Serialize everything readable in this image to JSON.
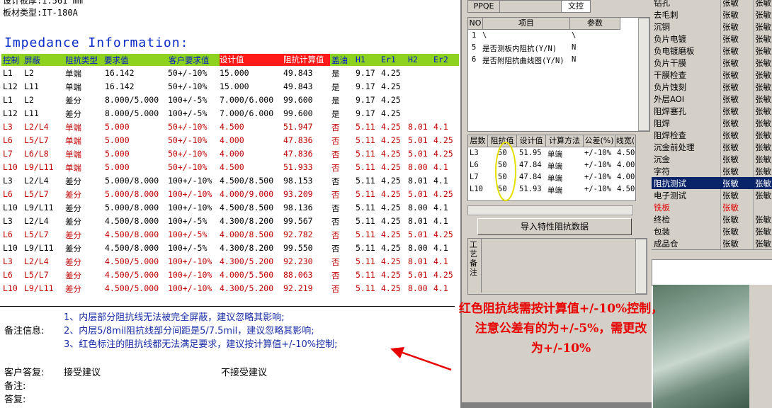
{
  "doc": {
    "header_line1": "设计板厚:1.561 mm",
    "header_line2": "板材类型:IT-180A",
    "impedance_title": "Impedance Information:",
    "columns": [
      "控制",
      "屏蔽",
      "阻抗类型",
      "要求值",
      "客户要求值",
      "设计值",
      "阻抗计算值",
      "盖油",
      "H1",
      "Er1",
      "H2",
      "Er2"
    ],
    "rows": [
      {
        "red": false,
        "c": [
          "L1",
          "L2",
          "单端",
          "16.142",
          "50+/-10%",
          "15.000",
          "49.843",
          "是",
          "9.17",
          "4.25",
          "",
          ""
        ]
      },
      {
        "red": false,
        "c": [
          "L12",
          "L11",
          "单端",
          "16.142",
          "50+/-10%",
          "15.000",
          "49.843",
          "是",
          "9.17",
          "4.25",
          "",
          ""
        ]
      },
      {
        "red": false,
        "c": [
          "L1",
          "L2",
          "差分",
          "8.000/5.000",
          "100+/-5%",
          "7.000/6.000",
          "99.600",
          "是",
          "9.17",
          "4.25",
          "",
          ""
        ]
      },
      {
        "red": false,
        "c": [
          "L12",
          "L11",
          "差分",
          "8.000/5.000",
          "100+/-5%",
          "7.000/6.000",
          "99.600",
          "是",
          "9.17",
          "4.25",
          "",
          ""
        ]
      },
      {
        "red": true,
        "c": [
          "L3",
          "L2/L4",
          "单端",
          "5.000",
          "50+/-10%",
          "4.500",
          "51.947",
          "否",
          "5.11",
          "4.25",
          "8.01",
          "4.1"
        ]
      },
      {
        "red": true,
        "c": [
          "L6",
          "L5/L7",
          "单端",
          "5.000",
          "50+/-10%",
          "4.000",
          "47.836",
          "否",
          "5.11",
          "4.25",
          "5.01",
          "4.25"
        ]
      },
      {
        "red": true,
        "c": [
          "L7",
          "L6/L8",
          "单端",
          "5.000",
          "50+/-10%",
          "4.000",
          "47.836",
          "否",
          "5.11",
          "4.25",
          "5.01",
          "4.25"
        ]
      },
      {
        "red": true,
        "c": [
          "L10",
          "L9/L11",
          "单端",
          "5.000",
          "50+/-10%",
          "4.500",
          "51.933",
          "否",
          "5.11",
          "4.25",
          "8.00",
          "4.1"
        ]
      },
      {
        "red": false,
        "c": [
          "L3",
          "L2/L4",
          "差分",
          "5.000/8.000",
          "100+/-10%",
          "4.500/8.500",
          "98.153",
          "否",
          "5.11",
          "4.25",
          "8.01",
          "4.1"
        ]
      },
      {
        "red": true,
        "c": [
          "L6",
          "L5/L7",
          "差分",
          "5.000/8.000",
          "100+/-10%",
          "4.000/9.000",
          "93.209",
          "否",
          "5.11",
          "4.25",
          "5.01",
          "4.25"
        ]
      },
      {
        "red": false,
        "c": [
          "L10",
          "L9/L11",
          "差分",
          "5.000/8.000",
          "100+/-10%",
          "4.500/8.500",
          "98.136",
          "否",
          "5.11",
          "4.25",
          "8.00",
          "4.1"
        ]
      },
      {
        "red": false,
        "c": [
          "L3",
          "L2/L4",
          "差分",
          "4.500/8.000",
          "100+/-5%",
          "4.300/8.200",
          "99.567",
          "否",
          "5.11",
          "4.25",
          "8.01",
          "4.1"
        ]
      },
      {
        "red": true,
        "c": [
          "L6",
          "L5/L7",
          "差分",
          "4.500/8.000",
          "100+/-5%",
          "4.000/8.500",
          "92.782",
          "否",
          "5.11",
          "4.25",
          "5.01",
          "4.25"
        ]
      },
      {
        "red": false,
        "c": [
          "L10",
          "L9/L11",
          "差分",
          "4.500/8.000",
          "100+/-5%",
          "4.300/8.200",
          "99.550",
          "否",
          "5.11",
          "4.25",
          "8.00",
          "4.1"
        ]
      },
      {
        "red": true,
        "c": [
          "L3",
          "L2/L4",
          "差分",
          "4.500/5.000",
          "100+/-10%",
          "4.300/5.200",
          "92.230",
          "否",
          "5.11",
          "4.25",
          "8.01",
          "4.1"
        ]
      },
      {
        "red": true,
        "c": [
          "L6",
          "L5/L7",
          "差分",
          "4.500/5.000",
          "100+/-10%",
          "4.000/5.500",
          "88.063",
          "否",
          "5.11",
          "4.25",
          "5.01",
          "4.25"
        ]
      },
      {
        "red": true,
        "c": [
          "L10",
          "L9/L11",
          "差分",
          "4.500/5.000",
          "100+/-10%",
          "4.300/5.200",
          "92.219",
          "否",
          "5.11",
          "4.25",
          "8.00",
          "4.1"
        ]
      }
    ],
    "notes_label": "备注信息:",
    "notes": [
      "1、内层部分阻抗线无法被完全屏蔽，建议忽略其影响;",
      "2、内层5/8mil阻抗线部分间距是5/7.5mil，建议忽略其影响;",
      "3、红色标注的阻抗线都无法满足要求，建议按计算值+/-10%控制;"
    ],
    "customer_reply_label": "客户答复:",
    "accept": "接受建议",
    "reject": "不接受建议",
    "remark_label": "备注:",
    "reply_label": "答复:"
  },
  "mid": {
    "tabs": [
      "PPQE",
      "",
      "文控"
    ],
    "param_headers": [
      "NO",
      "项目",
      "参数"
    ],
    "params": [
      {
        "no": "1",
        "item": "\\",
        "val": "\\"
      },
      {
        "no": "5",
        "item": "是否测板内阻抗(Y/N)",
        "val": "N"
      },
      {
        "no": "6",
        "item": "是否附阻抗曲线图(Y/N)",
        "val": "N"
      }
    ],
    "imp_headers": [
      "层数",
      "阻抗值",
      "设计值",
      "计算方法",
      "公差(%)",
      "线宽("
    ],
    "imp_rows": [
      [
        "L3",
        "50",
        "51.95",
        "单端",
        "+/-10%",
        "4.50"
      ],
      [
        "L6",
        "50",
        "47.84",
        "单端",
        "+/-10%",
        "4.00"
      ],
      [
        "L7",
        "50",
        "47.84",
        "单端",
        "+/-10%",
        "4.00"
      ],
      [
        "L10",
        "50",
        "51.93",
        "单端",
        "+/-10%",
        "4.50"
      ]
    ],
    "import_button": "导入特性阻抗数据",
    "craft_note_label": "工艺备注"
  },
  "right_list": [
    {
      "step": "钻孔",
      "p1": "张敏",
      "p2": "张敏",
      "sel": false,
      "red": false
    },
    {
      "step": "去毛刺",
      "p1": "张敏",
      "p2": "张敏",
      "sel": false,
      "red": false
    },
    {
      "step": "沉铜",
      "p1": "张敏",
      "p2": "张敏",
      "sel": false,
      "red": false
    },
    {
      "step": "负片电镀",
      "p1": "张敏",
      "p2": "张敏",
      "sel": false,
      "red": false
    },
    {
      "step": "负电镀磨板",
      "p1": "张敏",
      "p2": "张敏",
      "sel": false,
      "red": false
    },
    {
      "step": "负片干膜",
      "p1": "张敏",
      "p2": "张敏",
      "sel": false,
      "red": false
    },
    {
      "step": "干膜检查",
      "p1": "张敏",
      "p2": "张敏",
      "sel": false,
      "red": false
    },
    {
      "step": "负片蚀刻",
      "p1": "张敏",
      "p2": "张敏",
      "sel": false,
      "red": false
    },
    {
      "step": "外层AOI",
      "p1": "张敏",
      "p2": "张敏",
      "sel": false,
      "red": false
    },
    {
      "step": "阻焊塞孔",
      "p1": "张敏",
      "p2": "张敏",
      "sel": false,
      "red": false
    },
    {
      "step": "阻焊",
      "p1": "张敏",
      "p2": "张敏",
      "sel": false,
      "red": false
    },
    {
      "step": "阻焊检查",
      "p1": "张敏",
      "p2": "张敏",
      "sel": false,
      "red": false
    },
    {
      "step": "沉金前处理",
      "p1": "张敏",
      "p2": "张敏",
      "sel": false,
      "red": false
    },
    {
      "step": "沉金",
      "p1": "张敏",
      "p2": "张敏",
      "sel": false,
      "red": false
    },
    {
      "step": "字符",
      "p1": "张敏",
      "p2": "张敏",
      "sel": false,
      "red": false
    },
    {
      "step": "阻抗测试",
      "p1": "张敏",
      "p2": "张敏",
      "sel": true,
      "red": false
    },
    {
      "step": "电子测试",
      "p1": "张敏",
      "p2": "张敏",
      "sel": false,
      "red": false
    },
    {
      "step": "铣板",
      "p1": "张敏",
      "p2": "",
      "sel": false,
      "red": true
    },
    {
      "step": "终检",
      "p1": "张敏",
      "p2": "张敏",
      "sel": false,
      "red": false
    },
    {
      "step": "包装",
      "p1": "张敏",
      "p2": "张敏",
      "sel": false,
      "red": false
    },
    {
      "step": "成品仓",
      "p1": "张敏",
      "p2": "张敏",
      "sel": false,
      "red": false
    }
  ],
  "callout": {
    "line1": "红色阻抗线需按计算值+/-10%控制，",
    "line2": "注意公差有的为+/-5%，需更改",
    "line3": "为+/-10%",
    "color": "#e80000"
  }
}
